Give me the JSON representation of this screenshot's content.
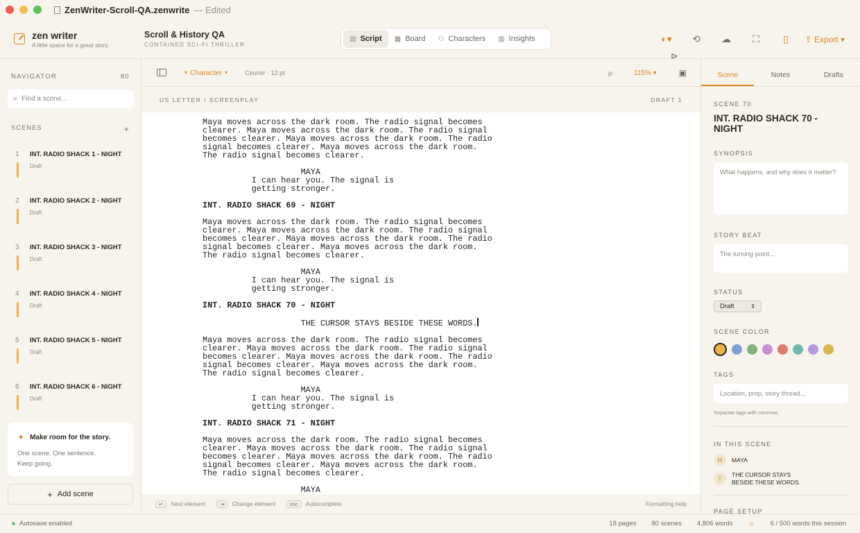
{
  "window": {
    "filename": "ZenWriter-Scroll-QA.zenwrite",
    "edited_label": "— Edited"
  },
  "brand": {
    "name": "zen writer",
    "tagline": "A little space for a great story."
  },
  "project": {
    "title": "Scroll & History QA",
    "subtitle": "CONTAINED SCI-FI THRILLER"
  },
  "views": [
    {
      "label": "Script",
      "icon": "script-icon",
      "active": true
    },
    {
      "label": "Board",
      "icon": "board-icon",
      "active": false
    },
    {
      "label": "Characters",
      "icon": "characters-icon",
      "active": false
    },
    {
      "label": "Insights",
      "icon": "insights-icon",
      "active": false
    }
  ],
  "toolbar": {
    "export_label": "Export"
  },
  "navigator": {
    "title": "NAVIGATOR",
    "count": "80",
    "search_placeholder": "Find a scene...",
    "scenes_label": "SCENES",
    "scenes": [
      {
        "num": "1",
        "title": "INT. RADIO SHACK 1 - NIGHT",
        "status": "Draft"
      },
      {
        "num": "2",
        "title": "INT. RADIO SHACK 2 - NIGHT",
        "status": "Draft"
      },
      {
        "num": "3",
        "title": "INT. RADIO SHACK 3 - NIGHT",
        "status": "Draft"
      },
      {
        "num": "4",
        "title": "INT. RADIO SHACK 4 - NIGHT",
        "status": "Draft"
      },
      {
        "num": "5",
        "title": "INT. RADIO SHACK 5 - NIGHT",
        "status": "Draft"
      },
      {
        "num": "6",
        "title": "INT. RADIO SHACK 6 - NIGHT",
        "status": "Draft"
      }
    ],
    "tip_title": "Make room for the story.",
    "tip_line1": "One scene. One sentence.",
    "tip_line2": "Keep going.",
    "add_scene_label": "Add scene"
  },
  "editor": {
    "element_type": "Character",
    "font_info": "Courier · 12 pt",
    "zoom": "115%",
    "page_format": "US LETTER  /  SCREENPLAY",
    "draft_label": "DRAFT 1",
    "script": [
      {
        "type": "action",
        "text": "Maya moves across the dark room. The radio signal becomes\nclearer. Maya moves across the dark room. The radio signal\nbecomes clearer. Maya moves across the dark room. The radio\nsignal becomes clearer. Maya moves across the dark room.\nThe radio signal becomes clearer."
      },
      {
        "type": "dialogue",
        "text": "                    MAYA\n          I can hear you. The signal is\n          getting stronger."
      },
      {
        "type": "heading",
        "text": "INT. RADIO SHACK 69 - NIGHT"
      },
      {
        "type": "action",
        "text": "Maya moves across the dark room. The radio signal becomes\nclearer. Maya moves across the dark room. The radio signal\nbecomes clearer. Maya moves across the dark room. The radio\nsignal becomes clearer. Maya moves across the dark room.\nThe radio signal becomes clearer."
      },
      {
        "type": "dialogue",
        "text": "                    MAYA\n          I can hear you. The signal is\n          getting stronger."
      },
      {
        "type": "heading",
        "text": "INT. RADIO SHACK 70 - NIGHT"
      },
      {
        "type": "cursor-line",
        "text": "                    THE CURSOR STAYS BESIDE THESE WORDS."
      },
      {
        "type": "action",
        "text": "Maya moves across the dark room. The radio signal becomes\nclearer. Maya moves across the dark room. The radio signal\nbecomes clearer. Maya moves across the dark room. The radio\nsignal becomes clearer. Maya moves across the dark room.\nThe radio signal becomes clearer."
      },
      {
        "type": "dialogue",
        "text": "                    MAYA\n          I can hear you. The signal is\n          getting stronger."
      },
      {
        "type": "heading",
        "text": "INT. RADIO SHACK 71 - NIGHT"
      },
      {
        "type": "action",
        "text": "Maya moves across the dark room. The radio signal becomes\nclearer. Maya moves across the dark room. The radio signal\nbecomes clearer. Maya moves across the dark room. The radio\nsignal becomes clearer. Maya moves across the dark room.\nThe radio signal becomes clearer."
      },
      {
        "type": "dialogue",
        "text": "                    MAYA\n          I can hear you. The signal is"
      }
    ],
    "footer": {
      "hints": [
        {
          "key": "↵",
          "label": "Next element"
        },
        {
          "key": "⇥",
          "label": "Change element"
        },
        {
          "key": "esc",
          "label": "Autocomplete"
        }
      ],
      "help": "Formatting help"
    }
  },
  "inspector": {
    "tabs": [
      {
        "label": "Scene",
        "active": true
      },
      {
        "label": "Notes",
        "active": false
      },
      {
        "label": "Drafts",
        "active": false
      }
    ],
    "scene_label": "SCENE 70",
    "scene_title": "INT. RADIO SHACK 70 - NIGHT",
    "synopsis_label": "SYNOPSIS",
    "synopsis_placeholder": "What happens, and why does it matter?",
    "beat_label": "STORY BEAT",
    "beat_placeholder": "The turning point...",
    "status_label": "STATUS",
    "status_value": "Draft",
    "color_label": "SCENE COLOR",
    "colors": [
      "#ecb448",
      "#7d9fd6",
      "#86b37a",
      "#c98fcf",
      "#e07a6a",
      "#6fb8b0",
      "#b39ae0",
      "#d6b74f"
    ],
    "selected_color_index": 0,
    "tags_label": "TAGS",
    "tags_placeholder": "Location, prop, story thread...",
    "tags_note": "Separate tags with commas.",
    "in_scene_label": "IN THIS SCENE",
    "characters": [
      {
        "initial": "M",
        "name": "MAYA"
      },
      {
        "initial": "T",
        "name": "THE CURSOR STAYS BESIDE THESE WORDS."
      }
    ],
    "page_setup_label": "PAGE SETUP"
  },
  "statusbar": {
    "autosave": "Autosave enabled",
    "pages": "18 pages",
    "scenes": "80 scenes",
    "words": "4,806 words",
    "session": "6 / 500 words this session"
  }
}
